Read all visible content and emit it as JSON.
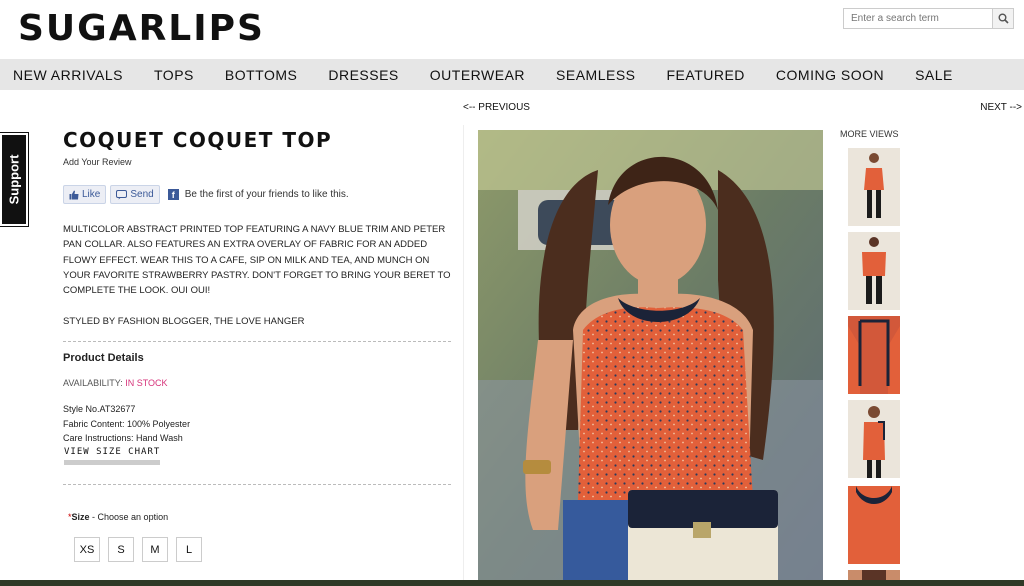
{
  "header": {
    "logo": "SUGARLIPS",
    "search": {
      "placeholder": "Enter a search term"
    }
  },
  "nav": [
    "NEW ARRIVALS",
    "TOPS",
    "BOTTOMS",
    "DRESSES",
    "OUTERWEAR",
    "SEAMLESS",
    "FEATURED",
    "COMING SOON",
    "SALE"
  ],
  "pager": {
    "previous": "<-- PREVIOUS",
    "next": "NEXT -->"
  },
  "support": "Support",
  "product": {
    "title": "COQUET COQUET TOP",
    "review_link": "Add Your Review",
    "social": {
      "like": "Like",
      "send": "Send",
      "friends_text": "Be the first of your friends to like this."
    },
    "description": "MULTICOLOR ABSTRACT PRINTED TOP FEATURING A NAVY BLUE TRIM AND PETER PAN COLLAR. ALSO FEATURES AN EXTRA OVERLAY OF FABRIC FOR AN ADDED FLOWY EFFECT. WEAR THIS TO A CAFE, SIP ON MILK AND TEA, AND MUNCH ON YOUR FAVORITE STRAWBERRY PASTRY. DON'T FORGET TO BRING YOUR BERET TO COMPLETE THE LOOK. OUI OUI!",
    "styled_by": "STYLED BY FASHION BLOGGER, THE LOVE HANGER",
    "details_heading": "Product Details",
    "availability_label": "AVAILABILITY:",
    "availability_value": "IN STOCK",
    "style_no": "Style No.AT32677",
    "fabric": "Fabric Content: 100% Polyester",
    "care": "Care Instructions: Hand Wash",
    "size_chart": "VIEW SIZE CHART",
    "size_required": "*",
    "size_label": "Size",
    "size_hint": " - Choose an option",
    "sizes": [
      "XS",
      "S",
      "M",
      "L"
    ]
  },
  "gallery": {
    "more_views": "MORE VIEWS"
  },
  "colors": {
    "nav_bg": "#e6e6e6",
    "stock": "#d6337a",
    "top_orange": "#e2603a",
    "collar_navy": "#1b2338"
  }
}
